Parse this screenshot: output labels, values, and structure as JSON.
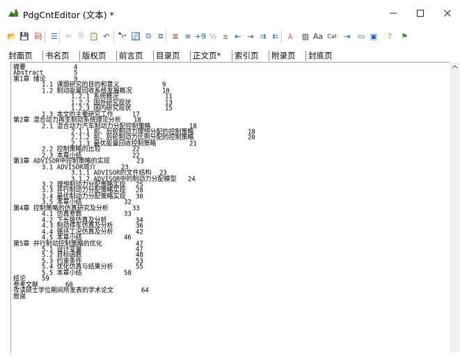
{
  "window": {
    "title": "PdgCntEditor (文本) *",
    "controls": {
      "minimize": "—",
      "maximize": "☐",
      "close": "✕"
    }
  },
  "toolbar": {
    "items": [
      {
        "icon": "open-folder-icon",
        "glyph": "📂"
      },
      {
        "icon": "save-disk-icon",
        "glyph": "💾"
      },
      {
        "icon": "encoding-icon",
        "glyph": "码"
      },
      {
        "icon": "indent-icon",
        "glyph": "☰"
      },
      {
        "icon": "cut-icon",
        "glyph": "✂"
      },
      {
        "icon": "copy-icon",
        "glyph": "⎘"
      },
      {
        "icon": "paste-icon",
        "glyph": "📋"
      },
      {
        "icon": "undo-icon",
        "glyph": "↶"
      },
      {
        "icon": "find-icon",
        "glyph": "🔭"
      },
      {
        "icon": "replace-icon",
        "glyph": "🔄"
      },
      {
        "icon": "page-offset-icon",
        "glyph": "⧉"
      },
      {
        "icon": "page-number-icon",
        "glyph": "⧈"
      },
      {
        "icon": "align-left-red-icon",
        "glyph": "≣"
      },
      {
        "icon": "align-left-icon",
        "glyph": "≡"
      },
      {
        "icon": "number-plus-icon",
        "glyph": "+9"
      },
      {
        "icon": "half-width-icon",
        "glyph": "½"
      },
      {
        "icon": "plus-level-icon",
        "glyph": "±"
      },
      {
        "icon": "decrease-indent-icon",
        "glyph": "⇤"
      },
      {
        "icon": "increase-indent-icon",
        "glyph": "⇥"
      },
      {
        "icon": "indent-level-icon",
        "glyph": "⇉"
      },
      {
        "icon": "outdent-level-icon",
        "glyph": "⇇"
      },
      {
        "icon": "pdf-icon",
        "glyph": "⅄"
      },
      {
        "icon": "bookmark-icon",
        "glyph": "▥"
      },
      {
        "icon": "font-icon",
        "glyph": "Aa"
      },
      {
        "icon": "cat-icon",
        "glyph": "Cat"
      },
      {
        "icon": "insert-icon",
        "glyph": "⇥"
      },
      {
        "icon": "window-icon",
        "glyph": "▭"
      },
      {
        "icon": "view-icon",
        "glyph": "▣"
      },
      {
        "icon": "help-icon",
        "glyph": "?"
      },
      {
        "icon": "pin-icon",
        "glyph": "⚑"
      }
    ]
  },
  "tabs": [
    "封面页",
    "书名页",
    "版权页",
    "前言页",
    "目录页",
    "正文页*",
    "索引页",
    "附录页",
    "封底页"
  ],
  "active_tab": "正文页*",
  "toc": [
    {
      "title": "摘要",
      "page": "4",
      "level": 0
    },
    {
      "title": "Abstract",
      "page": "5",
      "level": 0
    },
    {
      "title": "第1章 绪论",
      "page": "9",
      "level": 0
    },
    {
      "title": "1.1 课题研究的目的和意义",
      "page": "9",
      "level": 1
    },
    {
      "title": "1.2 制动能量回收系统发展概况",
      "page": "10",
      "level": 1
    },
    {
      "title": "1.2.1 系统概况",
      "page": "11",
      "level": 2
    },
    {
      "title": "1.2.2 国外研究现状",
      "page": "13",
      "level": 2
    },
    {
      "title": "1.2.3 国内研究现状",
      "page": "15",
      "level": 2
    },
    {
      "title": "1.3 本文的主要研究工作",
      "page": "17",
      "level": 1
    },
    {
      "title": "第2章 混合动力再生制动系统理论分析",
      "page": "18",
      "level": 0
    },
    {
      "title": "2.1 混合动力汽车制动力分配控制策略",
      "page": "18",
      "level": 1
    },
    {
      "title": "2.1.1 前、后轮制动力理想分配的控制策略",
      "page": "18",
      "level": 2
    },
    {
      "title": "2.1.2 前、后轮制动力比例分配的控制策略",
      "page": "20",
      "level": 2
    },
    {
      "title": "2.1.3 最优能量回收控制策略",
      "page": "21",
      "level": 2
    },
    {
      "title": "2.2 控制策略的比较",
      "page": "22",
      "level": 1
    },
    {
      "title": "2.3 本章小结",
      "page": "22",
      "level": 1
    },
    {
      "title": "第3章 ADVISOR中控制策略的实现",
      "page": "23",
      "level": 0
    },
    {
      "title": "3.1 ADVISOR简介",
      "page": "23",
      "level": 1
    },
    {
      "title": "3.1.1 ADVISOR的文件结构",
      "page": "23",
      "level": 2
    },
    {
      "title": "3.1.2 ADVISOR中的制动力分配模型",
      "page": "24",
      "level": 2
    },
    {
      "title": "3.2 理想制动力分配策略实现",
      "page": "25",
      "level": 1
    },
    {
      "title": "3.3 并行制动力分配策略实现",
      "page": "28",
      "level": 1
    },
    {
      "title": "3.4 最优制动力分配策略实现",
      "page": "30",
      "level": 1
    },
    {
      "title": "3.5 本章小结",
      "page": "32",
      "level": 1
    },
    {
      "title": "第4章 控制策略的仿真研究及分析",
      "page": "33",
      "level": 0
    },
    {
      "title": "4.1 仿真参数",
      "page": "33",
      "level": 1
    },
    {
      "title": "4.2 下长坡仿真及分析",
      "page": "34",
      "level": 1
    },
    {
      "title": "4.3 制动停车仿真及分析",
      "page": "36",
      "level": 1
    },
    {
      "title": "4.4 循环工况仿真及分析",
      "page": "42",
      "level": 1
    },
    {
      "title": "4.5 本章小结",
      "page": "46",
      "level": 1
    },
    {
      "title": "第5章 并行制动控制策略的优化",
      "page": "47",
      "level": 0
    },
    {
      "title": "5.1 设计变量",
      "page": "47",
      "level": 1
    },
    {
      "title": "5.2 目标函数",
      "page": "48",
      "level": 1
    },
    {
      "title": "5.3 约束条件",
      "page": "53",
      "level": 1
    },
    {
      "title": "5.4 优化仿真与结果分析",
      "page": "55",
      "level": 1
    },
    {
      "title": "5.5 本章小结",
      "page": "58",
      "level": 1
    },
    {
      "title": "结论",
      "page": "59",
      "level": 0
    },
    {
      "title": "参考文献",
      "page": "60",
      "level": 0
    },
    {
      "title": "攻读硕士学位期间所发表的学术论文",
      "page": "64",
      "level": 0
    },
    {
      "title": "致谢",
      "page": "",
      "level": 0
    }
  ],
  "colors": {
    "accent_red": "#e0301e",
    "toolbar_blue": "#1f5fbf",
    "icon_green": "#3c8c2c"
  }
}
